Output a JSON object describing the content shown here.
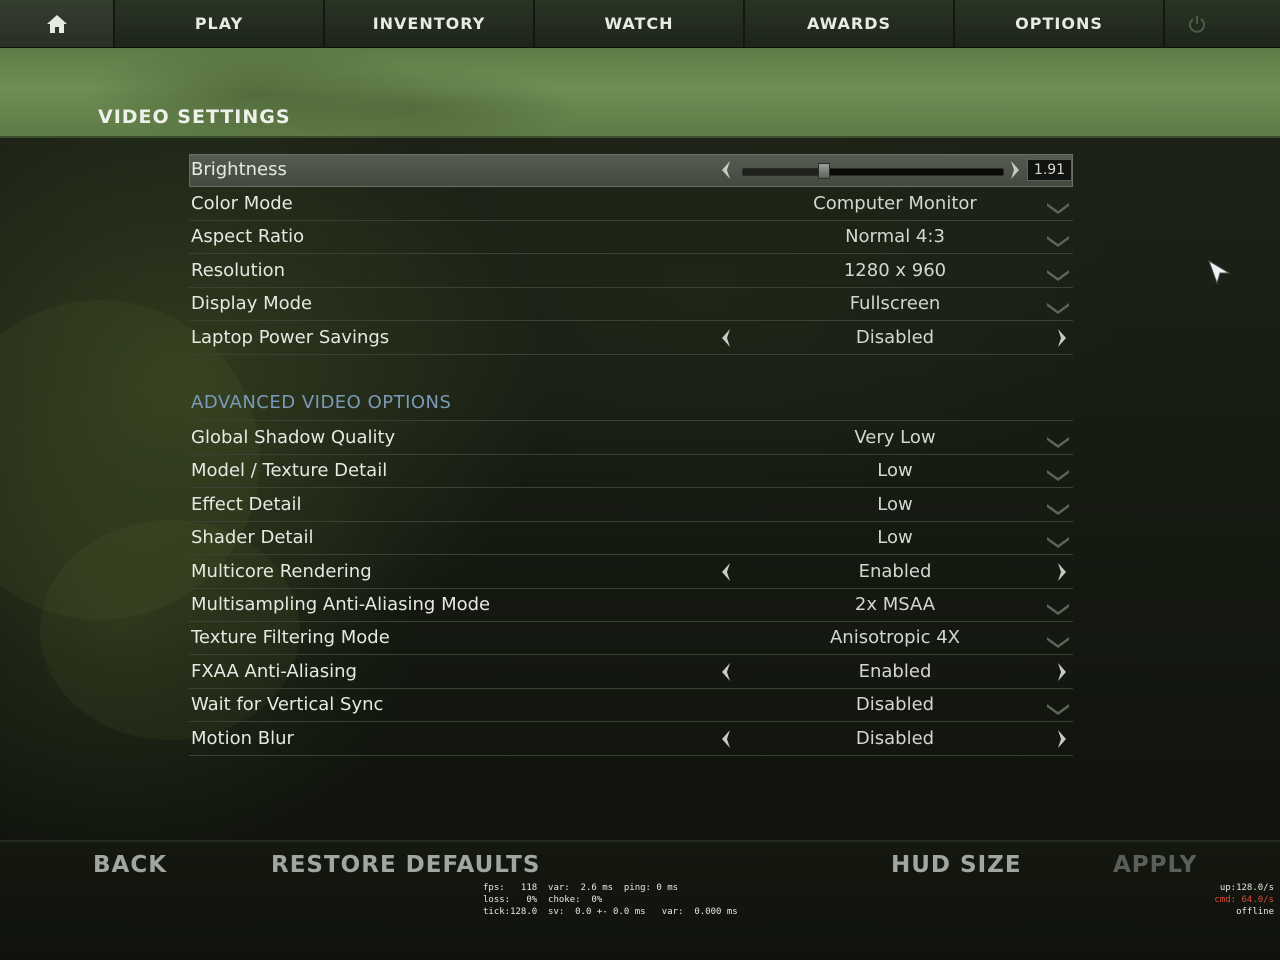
{
  "nav": {
    "home_icon": "home-icon",
    "play": "PLAY",
    "inventory": "INVENTORY",
    "watch": "WATCH",
    "awards": "AWARDS",
    "options": "OPTIONS",
    "power_icon": "power-icon"
  },
  "page_title": "VIDEO SETTINGS",
  "brightness": {
    "label": "Brightness",
    "value": "1.91",
    "slider_fraction": 0.31
  },
  "basic_settings": [
    {
      "label": "Color Mode",
      "value": "Computer Monitor",
      "control": "dropdown"
    },
    {
      "label": "Aspect Ratio",
      "value": "Normal 4:3",
      "control": "dropdown"
    },
    {
      "label": "Resolution",
      "value": "1280 x 960",
      "control": "dropdown"
    },
    {
      "label": "Display Mode",
      "value": "Fullscreen",
      "control": "dropdown"
    },
    {
      "label": "Laptop Power Savings",
      "value": "Disabled",
      "control": "toggle"
    }
  ],
  "advanced_header": "ADVANCED VIDEO OPTIONS",
  "advanced_settings": [
    {
      "label": "Global Shadow Quality",
      "value": "Very Low",
      "control": "dropdown"
    },
    {
      "label": "Model / Texture Detail",
      "value": "Low",
      "control": "dropdown"
    },
    {
      "label": "Effect Detail",
      "value": "Low",
      "control": "dropdown"
    },
    {
      "label": "Shader Detail",
      "value": "Low",
      "control": "dropdown"
    },
    {
      "label": "Multicore Rendering",
      "value": "Enabled",
      "control": "toggle"
    },
    {
      "label": "Multisampling Anti-Aliasing Mode",
      "value": "2x MSAA",
      "control": "dropdown"
    },
    {
      "label": "Texture Filtering Mode",
      "value": "Anisotropic 4X",
      "control": "dropdown"
    },
    {
      "label": "FXAA Anti-Aliasing",
      "value": "Enabled",
      "control": "toggle"
    },
    {
      "label": "Wait for Vertical Sync",
      "value": "Disabled",
      "control": "dropdown"
    },
    {
      "label": "Motion Blur",
      "value": "Disabled",
      "control": "toggle"
    }
  ],
  "bottom": {
    "back": "BACK",
    "restore_defaults": "RESTORE DEFAULTS",
    "hud_size": "HUD SIZE",
    "apply": "APPLY"
  },
  "netgraph": {
    "line1": "fps:   118  var:  2.6 ms  ping: 0 ms",
    "line2": "loss:   0%  choke:  0%",
    "line3": "tick:128.0  sv:  0.0 +- 0.0 ms   var:  0.000 ms",
    "up": "up:128.0/s",
    "cmd": "cmd: 64.0/s",
    "status": "offline"
  },
  "colors": {
    "advanced_header": "#7b9ab7",
    "banner": "#6f8e55",
    "cmd_rate": "#d84a3a"
  }
}
